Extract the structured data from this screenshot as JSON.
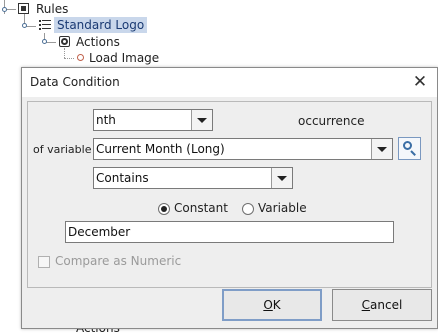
{
  "tree": {
    "rules_label": "Rules",
    "standard_logo_label": "Standard Logo",
    "actions_label": "Actions",
    "load_image_label": "Load Image",
    "bottom_actions_label": "Actions"
  },
  "dialog": {
    "title": "Data Condition",
    "nth_value": "nth",
    "occurrence_label": "occurrence",
    "of_variable_label": "of variable",
    "variable_value": "Current Month (Long)",
    "operator_value": "Contains",
    "constant_label": "Constant",
    "variable_option_label": "Variable",
    "constant_selected": true,
    "text_value": "December",
    "compare_numeric_label": "Compare as Numeric",
    "compare_numeric_checked": false,
    "ok_mnemonic": "O",
    "ok_rest": "K",
    "cancel_mnemonic": "C",
    "cancel_rest": "ancel"
  },
  "colors": {
    "selection": "#c9d7eb",
    "dialog_bg": "#eeeeee",
    "default_button_border": "#7f9dc7"
  }
}
